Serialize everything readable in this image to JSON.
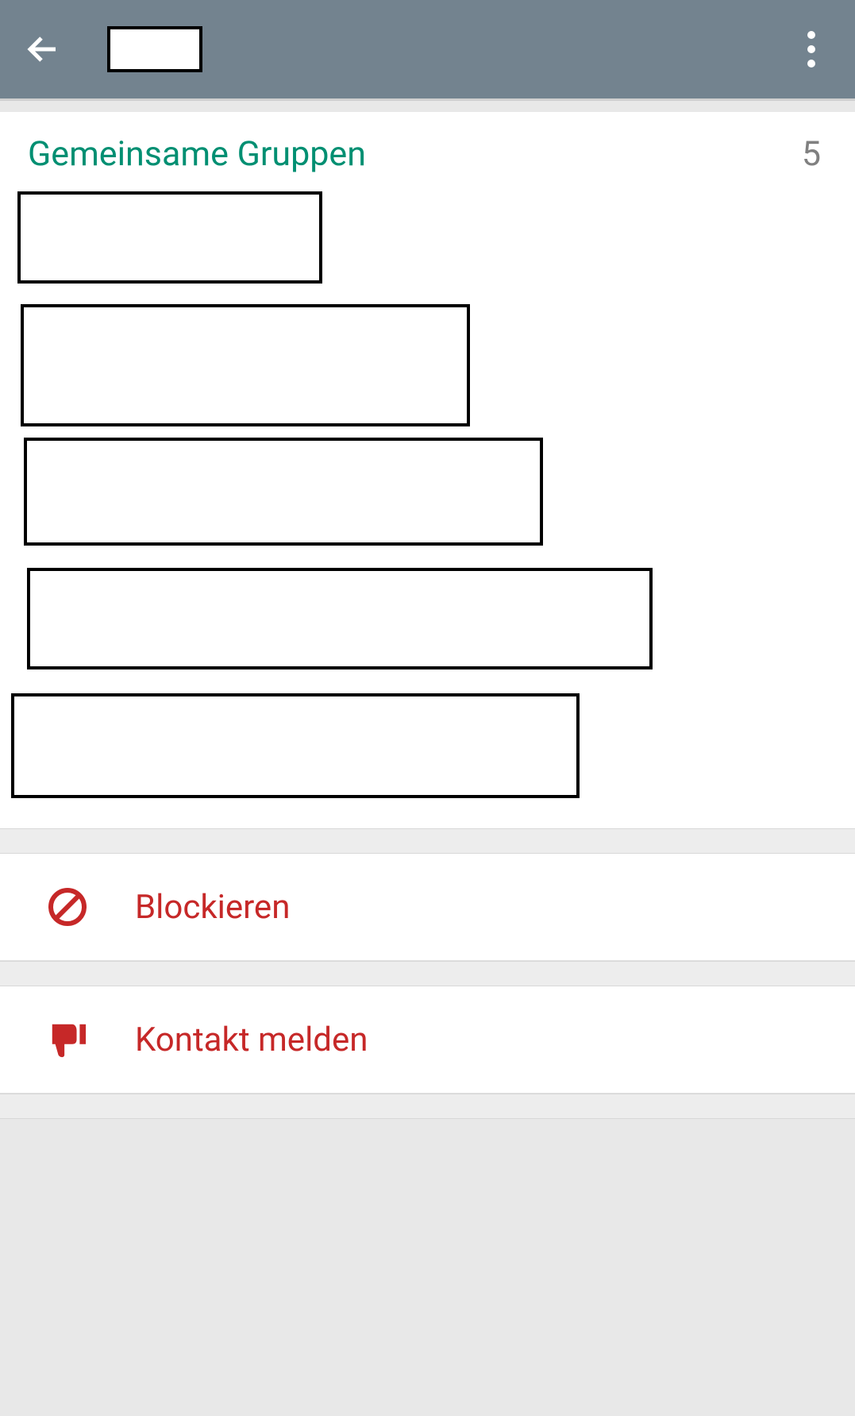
{
  "groups": {
    "title": "Gemeinsame Gruppen",
    "count": "5"
  },
  "actions": {
    "block_label": "Blockieren",
    "report_label": "Kontakt melden"
  }
}
